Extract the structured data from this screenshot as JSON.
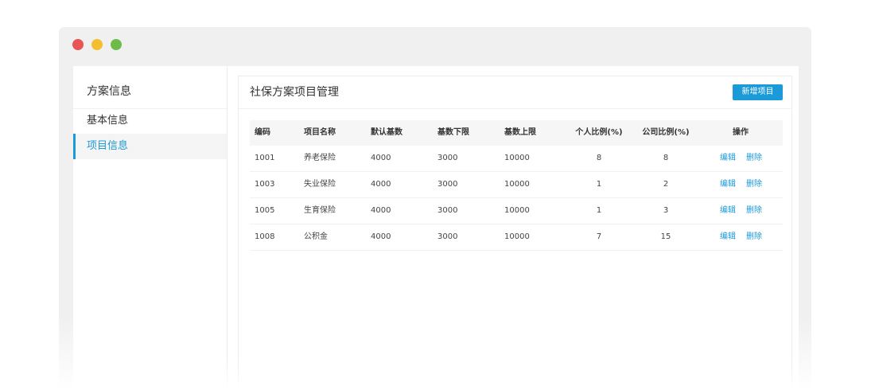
{
  "sidebar": {
    "title": "方案信息",
    "items": [
      {
        "label": "基本信息"
      },
      {
        "label": "项目信息"
      }
    ]
  },
  "main": {
    "title": "社保方案项目管理",
    "add_button": "新增项目"
  },
  "table": {
    "columns": [
      "编码",
      "项目名称",
      "默认基数",
      "基数下限",
      "基数上限",
      "个人比例(%)",
      "公司比例(%)",
      "操作"
    ],
    "rows": [
      {
        "code": "1001",
        "name": "养老保险",
        "base": "4000",
        "lower": "3000",
        "upper": "10000",
        "personal": "8",
        "company": "8"
      },
      {
        "code": "1003",
        "name": "失业保险",
        "base": "4000",
        "lower": "3000",
        "upper": "10000",
        "personal": "1",
        "company": "2"
      },
      {
        "code": "1005",
        "name": "生育保险",
        "base": "4000",
        "lower": "3000",
        "upper": "10000",
        "personal": "1",
        "company": "3"
      },
      {
        "code": "1008",
        "name": "公积金",
        "base": "4000",
        "lower": "3000",
        "upper": "10000",
        "personal": "7",
        "company": "15"
      }
    ],
    "actions": {
      "edit": "编辑",
      "delete": "删除"
    }
  },
  "colors": {
    "accent": "#1a9ad6",
    "window_close": "#e95554",
    "window_minimize": "#f3bf2e",
    "window_maximize": "#6fbb4a"
  }
}
